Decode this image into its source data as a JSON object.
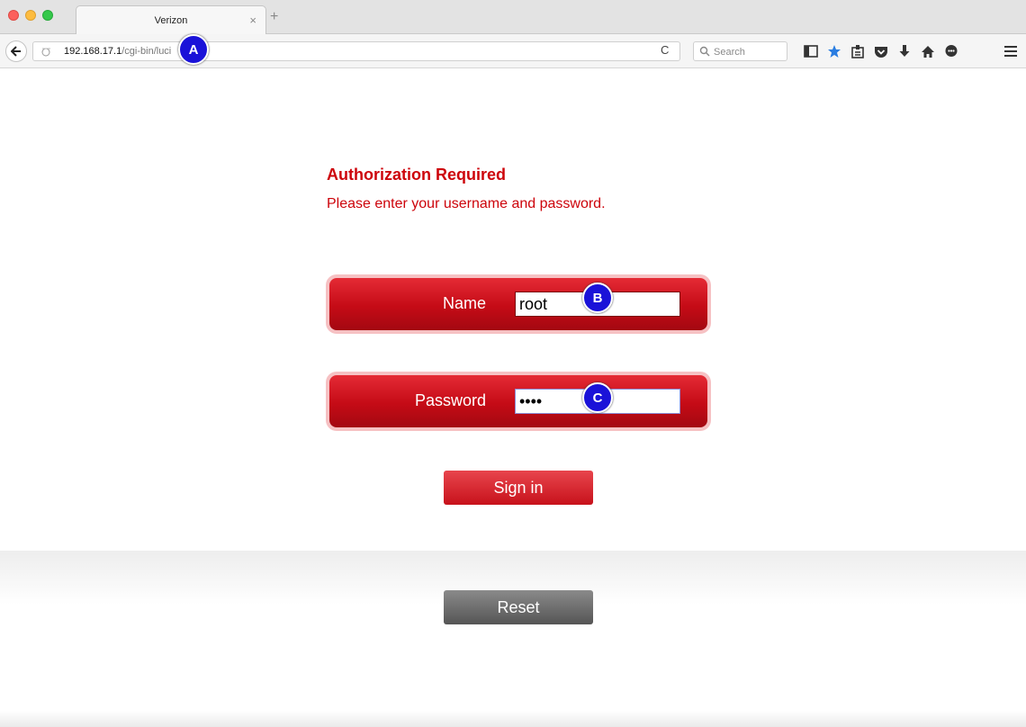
{
  "browser": {
    "tab_title": "Verizon",
    "tab_close": "×",
    "new_tab": "+",
    "url_host": "192.168.17.1",
    "url_path": "/cgi-bin/luci",
    "search_placeholder": "Search",
    "reload_glyph": "C"
  },
  "page": {
    "title": "Authorization Required",
    "subtitle": "Please enter your username and password.",
    "name_label": "Name",
    "name_value": "root",
    "password_label": "Password",
    "password_value": "••••",
    "signin_label": "Sign in",
    "reset_label": "Reset"
  },
  "markers": {
    "a": "A",
    "b": "B",
    "c": "C"
  },
  "colors": {
    "brand_red": "#cd040b",
    "marker_blue": "#1a12d8"
  }
}
